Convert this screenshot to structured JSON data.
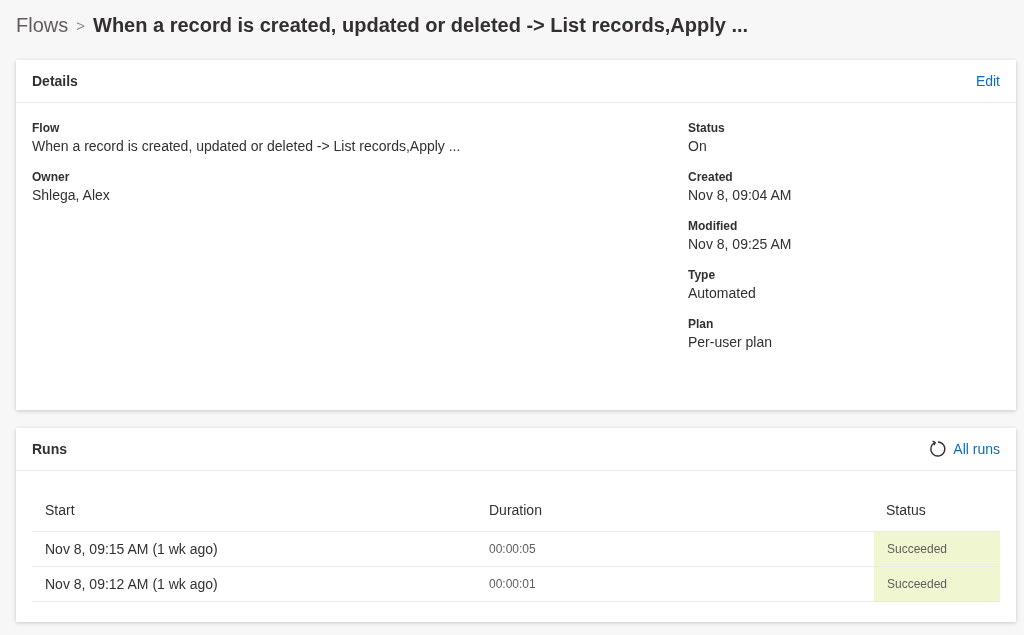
{
  "breadcrumb": {
    "parent": "Flows",
    "separator": ">",
    "title": "When a record is created, updated or deleted -> List records,Apply ..."
  },
  "details": {
    "title": "Details",
    "action": "Edit",
    "left": [
      {
        "label": "Flow",
        "value": "When a record is created, updated or deleted -> List records,Apply ..."
      },
      {
        "label": "Owner",
        "value": "Shlega, Alex"
      }
    ],
    "right": [
      {
        "label": "Status",
        "value": "On"
      },
      {
        "label": "Created",
        "value": "Nov 8, 09:04 AM"
      },
      {
        "label": "Modified",
        "value": "Nov 8, 09:25 AM"
      },
      {
        "label": "Type",
        "value": "Automated"
      },
      {
        "label": "Plan",
        "value": "Per-user plan"
      }
    ]
  },
  "runs": {
    "title": "Runs",
    "action": "All runs",
    "columns": [
      "Start",
      "Duration",
      "Status"
    ],
    "rows": [
      {
        "start": "Nov 8, 09:15 AM (1 wk ago)",
        "duration": "00:00:05",
        "status": "Succeeded",
        "kind": "succeeded"
      },
      {
        "start": "Nov 8, 09:12 AM (1 wk ago)",
        "duration": "00:00:01",
        "status": "Succeeded",
        "kind": "succeeded"
      }
    ]
  }
}
